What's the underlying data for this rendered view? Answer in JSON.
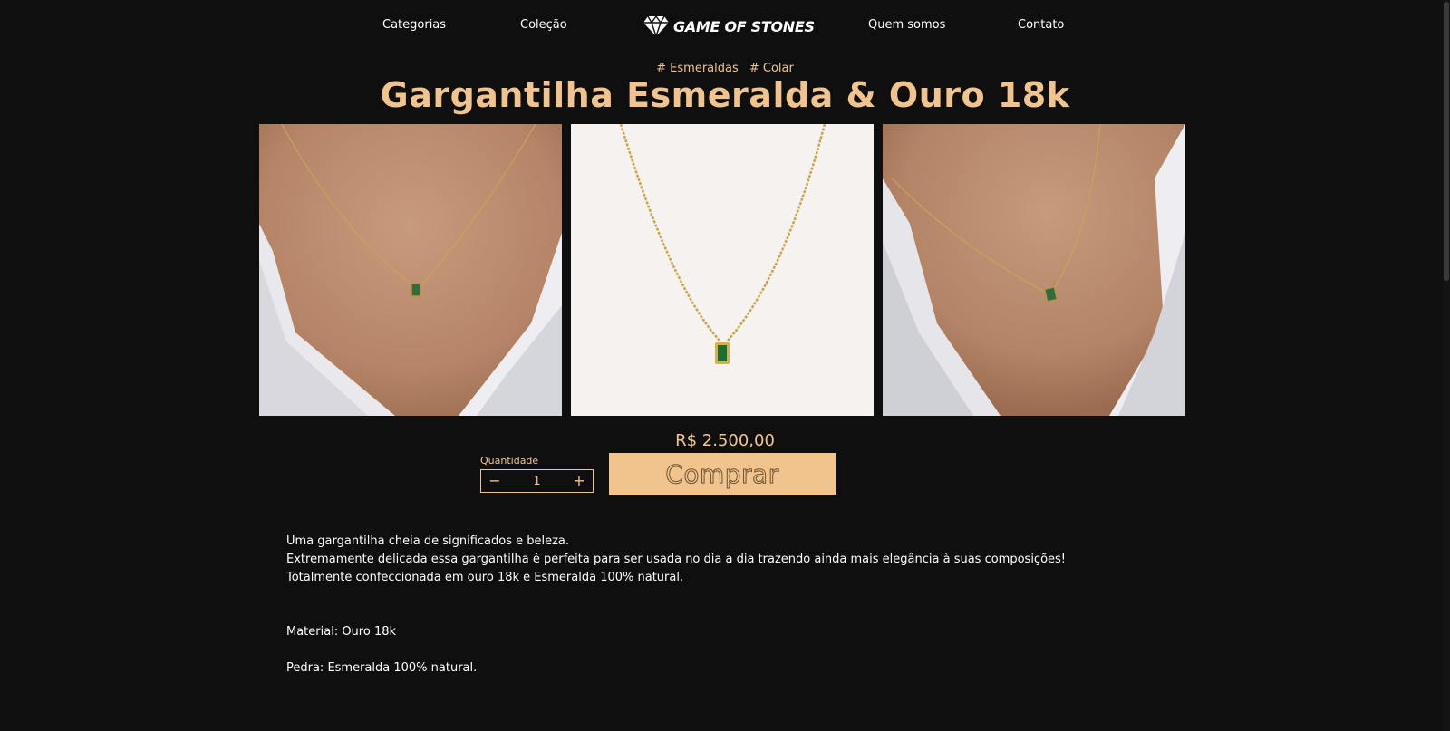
{
  "nav": {
    "categorias": "Categorias",
    "colecao": "Coleção",
    "logo_text": "GAME OF STONES",
    "quem_somos": "Quem somos",
    "contato": "Contato"
  },
  "product": {
    "tags": [
      "# Esmeraldas",
      "# Colar"
    ],
    "title": "Gargantilha Esmeralda & Ouro 18k",
    "price": "R$ 2.500,00",
    "quantity_label": "Quantidade",
    "quantity_value": "1",
    "buy_label": "Comprar",
    "description": [
      "Uma gargantilha cheia de significados e beleza.",
      "Extremamente delicada essa gargantilha é perfeita para ser usada no dia a dia trazendo ainda mais elegância à suas composições!",
      "Totalmente confeccionada em ouro 18k e Esmeralda 100% natural.",
      "Material: Ouro 18k",
      "Pedra: Esmeralda 100% natural."
    ]
  },
  "colors": {
    "background": "#0f0f0f",
    "accent": "#f2c48d",
    "text": "#ffffff"
  },
  "icons": [
    "diamond-logo-icon",
    "minus-icon",
    "plus-icon"
  ]
}
